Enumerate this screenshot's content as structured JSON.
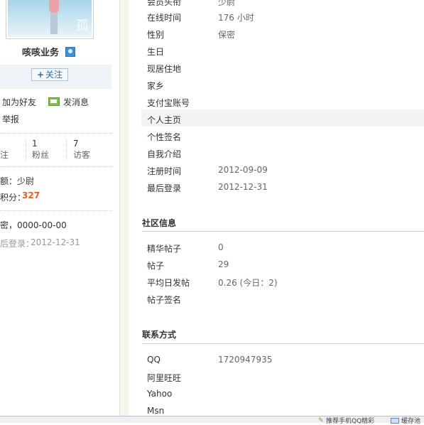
{
  "profile": {
    "username": "咳咳业务",
    "follow_label": "关注",
    "actions": {
      "add_friend": "加为好友",
      "send_message": "发消息",
      "report": "举报"
    },
    "stats": [
      {
        "value": "",
        "label": "注"
      },
      {
        "value": "1",
        "label": "粉丝"
      },
      {
        "value": "7",
        "label": "访客"
      }
    ],
    "rank_text": "额：少尉",
    "credits_label": "积分：",
    "credits_value": "327",
    "birthday_text": "密，0000-00-00",
    "last_login_label": "后登录：",
    "last_login_value": "2012-12-31",
    "photo_watermark": "孤"
  },
  "basic_info": {
    "rows": [
      {
        "label": "会员头衔",
        "value": "少尉"
      },
      {
        "label": "在线时间",
        "value": "176 小时"
      },
      {
        "label": "性别",
        "value": "保密"
      },
      {
        "label": "生日",
        "value": ""
      },
      {
        "label": "现居住地",
        "value": ""
      },
      {
        "label": "家乡",
        "value": ""
      },
      {
        "label": "支付宝账号",
        "value": ""
      },
      {
        "label": "个人主页",
        "value": ""
      },
      {
        "label": "个性签名",
        "value": ""
      },
      {
        "label": "自我介绍",
        "value": ""
      },
      {
        "label": "注册时间",
        "value": "2012-09-09"
      },
      {
        "label": "最后登录",
        "value": "2012-12-31"
      }
    ]
  },
  "community": {
    "title": "社区信息",
    "rows": [
      {
        "label": "精华帖子",
        "value": "0"
      },
      {
        "label": "帖子",
        "value": "29"
      },
      {
        "label": "平均日发帖",
        "value": "0.26 (今日：2)"
      },
      {
        "label": "帖子签名",
        "value": ""
      }
    ]
  },
  "contact": {
    "title": "联系方式",
    "rows": [
      {
        "label": "QQ",
        "value": "1720947935"
      },
      {
        "label": "阿里旺旺",
        "value": ""
      },
      {
        "label": "Yahoo",
        "value": ""
      },
      {
        "label": "Msn",
        "value": ""
      }
    ]
  },
  "statusbar": {
    "item1": "推荐手机QQ精彩",
    "item2": "缓存池"
  },
  "colors": {
    "credits": "#e0621f",
    "section_line": "#c2d5e3",
    "follow_bg": "#eef3f8"
  }
}
